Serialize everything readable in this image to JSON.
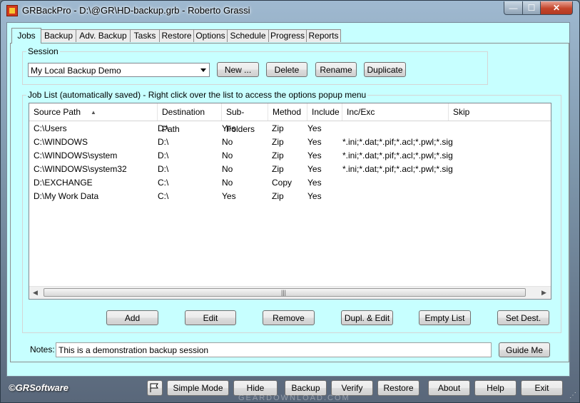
{
  "window": {
    "title": "GRBackPro - D:\\@GR\\HD-backup.grb - Roberto Grassi",
    "min": "—",
    "max": "☐",
    "close": "✕"
  },
  "tabs": [
    "Jobs",
    "Backup",
    "Adv. Backup",
    "Tasks",
    "Restore",
    "Options",
    "Schedule",
    "Progress",
    "Reports"
  ],
  "session": {
    "label": "Session",
    "selected": "My Local Backup Demo",
    "buttons": {
      "new": "New ...",
      "delete": "Delete",
      "rename": "Rename",
      "duplicate": "Duplicate"
    }
  },
  "joblist": {
    "label": "Job List (automatically saved) - Right click over the list to access the options popup menu",
    "columns": [
      "Source Path",
      "Destination Path",
      "Sub-Folders",
      "Method",
      "Include",
      "Inc/Exc",
      "Skip"
    ],
    "rows": [
      [
        "C:\\Users",
        "D:\\",
        "Yes",
        "Zip",
        "Yes",
        "",
        ""
      ],
      [
        "C:\\WINDOWS",
        "D:\\",
        "No",
        "Zip",
        "Yes",
        "*.ini;*.dat;*.pif;*.acl;*.pwl;*.sig",
        ""
      ],
      [
        "C:\\WINDOWS\\system",
        "D:\\",
        "No",
        "Zip",
        "Yes",
        "*.ini;*.dat;*.pif;*.acl;*.pwl;*.sig",
        ""
      ],
      [
        "C:\\WINDOWS\\system32",
        "D:\\",
        "No",
        "Zip",
        "Yes",
        "*.ini;*.dat;*.pif;*.acl;*.pwl;*.sig",
        ""
      ],
      [
        "D:\\EXCHANGE",
        "C:\\",
        "No",
        "Copy",
        "Yes",
        "",
        ""
      ],
      [
        "D:\\My Work Data",
        "C:\\",
        "Yes",
        "Zip",
        "Yes",
        "",
        ""
      ]
    ],
    "buttons": {
      "add": "Add",
      "edit": "Edit",
      "remove": "Remove",
      "dupl_edit": "Dupl. & Edit",
      "empty_list": "Empty List",
      "set_dest": "Set Dest."
    }
  },
  "notes": {
    "label": "Notes:",
    "value": "This is a demonstration backup session",
    "guide_button": "Guide Me"
  },
  "footer": {
    "brand": "©GRSoftware",
    "buttons": {
      "simple_mode": "Simple Mode",
      "hide": "Hide",
      "backup": "Backup",
      "verify": "Verify",
      "restore": "Restore",
      "about": "About",
      "help": "Help",
      "exit": "Exit"
    },
    "watermark": "GEARDOWNLOAD.COM"
  }
}
